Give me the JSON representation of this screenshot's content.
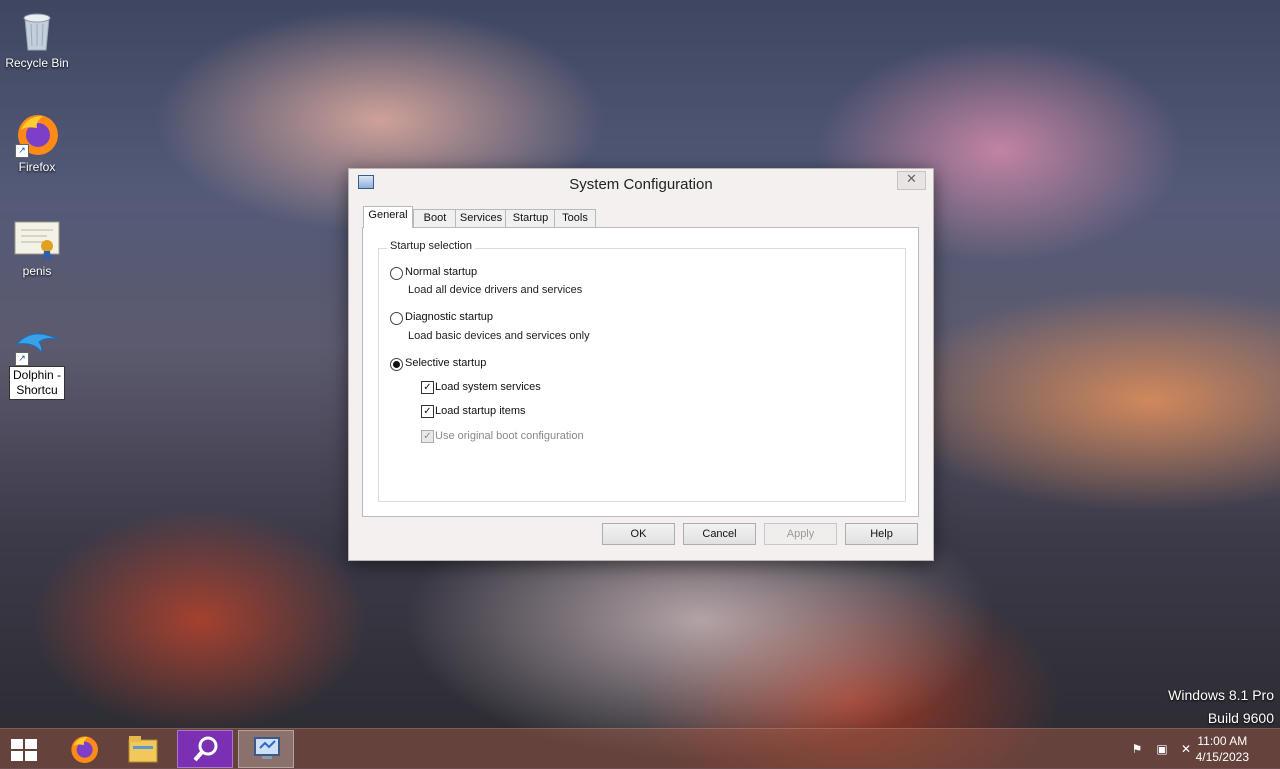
{
  "desktop": {
    "icons": [
      {
        "label": "Recycle Bin",
        "icon": "recycle-bin-icon"
      },
      {
        "label": "Firefox",
        "icon": "firefox-icon"
      },
      {
        "label": "penis",
        "icon": "certificate-icon"
      },
      {
        "label_line1": "Dolphin -",
        "label_line2": "Shortcu",
        "icon": "dolphin-icon"
      }
    ],
    "watermark": {
      "line1": "Windows 8.1 Pro",
      "line2": "Build 9600"
    }
  },
  "dialog": {
    "title": "System Configuration",
    "tabs": [
      {
        "label": "General",
        "active": true
      },
      {
        "label": "Boot",
        "active": false
      },
      {
        "label": "Services",
        "active": false
      },
      {
        "label": "Startup",
        "active": false
      },
      {
        "label": "Tools",
        "active": false
      }
    ],
    "group_title": "Startup selection",
    "options": {
      "normal": {
        "label": "Normal startup",
        "desc": "Load all device drivers and services",
        "selected": false
      },
      "diagnostic": {
        "label": "Diagnostic startup",
        "desc": "Load basic devices and services only",
        "selected": false
      },
      "selective": {
        "label": "Selective startup",
        "selected": true
      }
    },
    "checkboxes": {
      "system_services": {
        "label": "Load system services",
        "checked": true
      },
      "startup_items": {
        "label": "Load startup items",
        "checked": true
      },
      "original_boot": {
        "label": "Use original boot configuration",
        "checked": true,
        "disabled": true
      }
    },
    "buttons": {
      "ok": "OK",
      "cancel": "Cancel",
      "apply": "Apply",
      "help": "Help"
    },
    "close": "✕"
  },
  "taskbar": {
    "apps": [
      "start-icon",
      "firefox-icon",
      "file-explorer-icon",
      "search-icon",
      "system-configuration-icon"
    ],
    "tray": [
      "flag-icon",
      "network-icon",
      "volume-muted-icon"
    ],
    "time": "11:00 AM",
    "date": "4/15/2023"
  },
  "colors": {
    "accent_search": "#7b2fb3",
    "taskbar": "#965546"
  }
}
